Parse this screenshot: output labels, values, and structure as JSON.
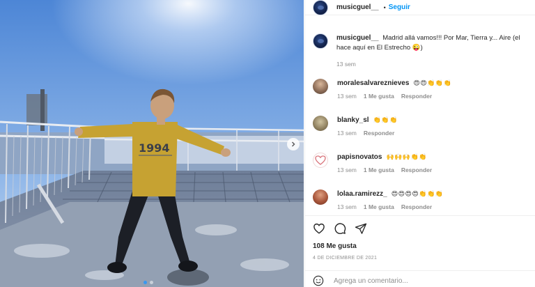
{
  "post": {
    "photo_alt": "foto",
    "header": {
      "username": "musicguel__",
      "separator": "•",
      "follow_label": "Seguir"
    },
    "caption": {
      "username": "musicguel__",
      "text": "Madrid allá vamos!!! Por Mar, Tierra y... Aire (el hace aquí en El Estrecho 😜)",
      "time": "13 sem"
    },
    "comments": [
      {
        "username": "moralesalvareznieves",
        "text": "😍😍👏👏👏",
        "time": "13 sem",
        "likes": "1 Me gusta",
        "reply": "Responder"
      },
      {
        "username": "blanky_sl",
        "text": "👏👏👏",
        "time": "13 sem",
        "likes": "",
        "reply": "Responder"
      },
      {
        "username": "papisnovatos",
        "text": "🙌🙌🙌👏👏",
        "time": "13 sem",
        "likes": "1 Me gusta",
        "reply": "Responder"
      },
      {
        "username": "lolaa.ramirezz_",
        "text": "😍😍😍😍👏👏👏",
        "time": "13 sem",
        "likes": "1 Me gusta",
        "reply": "Responder"
      }
    ],
    "icons": {
      "like": "heart-icon",
      "comment": "comment-icon",
      "share": "share-icon",
      "emoji": "smiley-icon",
      "next": "chevron-right-icon"
    },
    "likes_count": "108 Me gusta",
    "date": "4 DE DICIEMBRE DE 2021",
    "add_comment_placeholder": "Agrega un comentario...",
    "colors": {
      "accent": "#0095f6",
      "meta": "#8e8e8e",
      "text": "#262626"
    }
  }
}
